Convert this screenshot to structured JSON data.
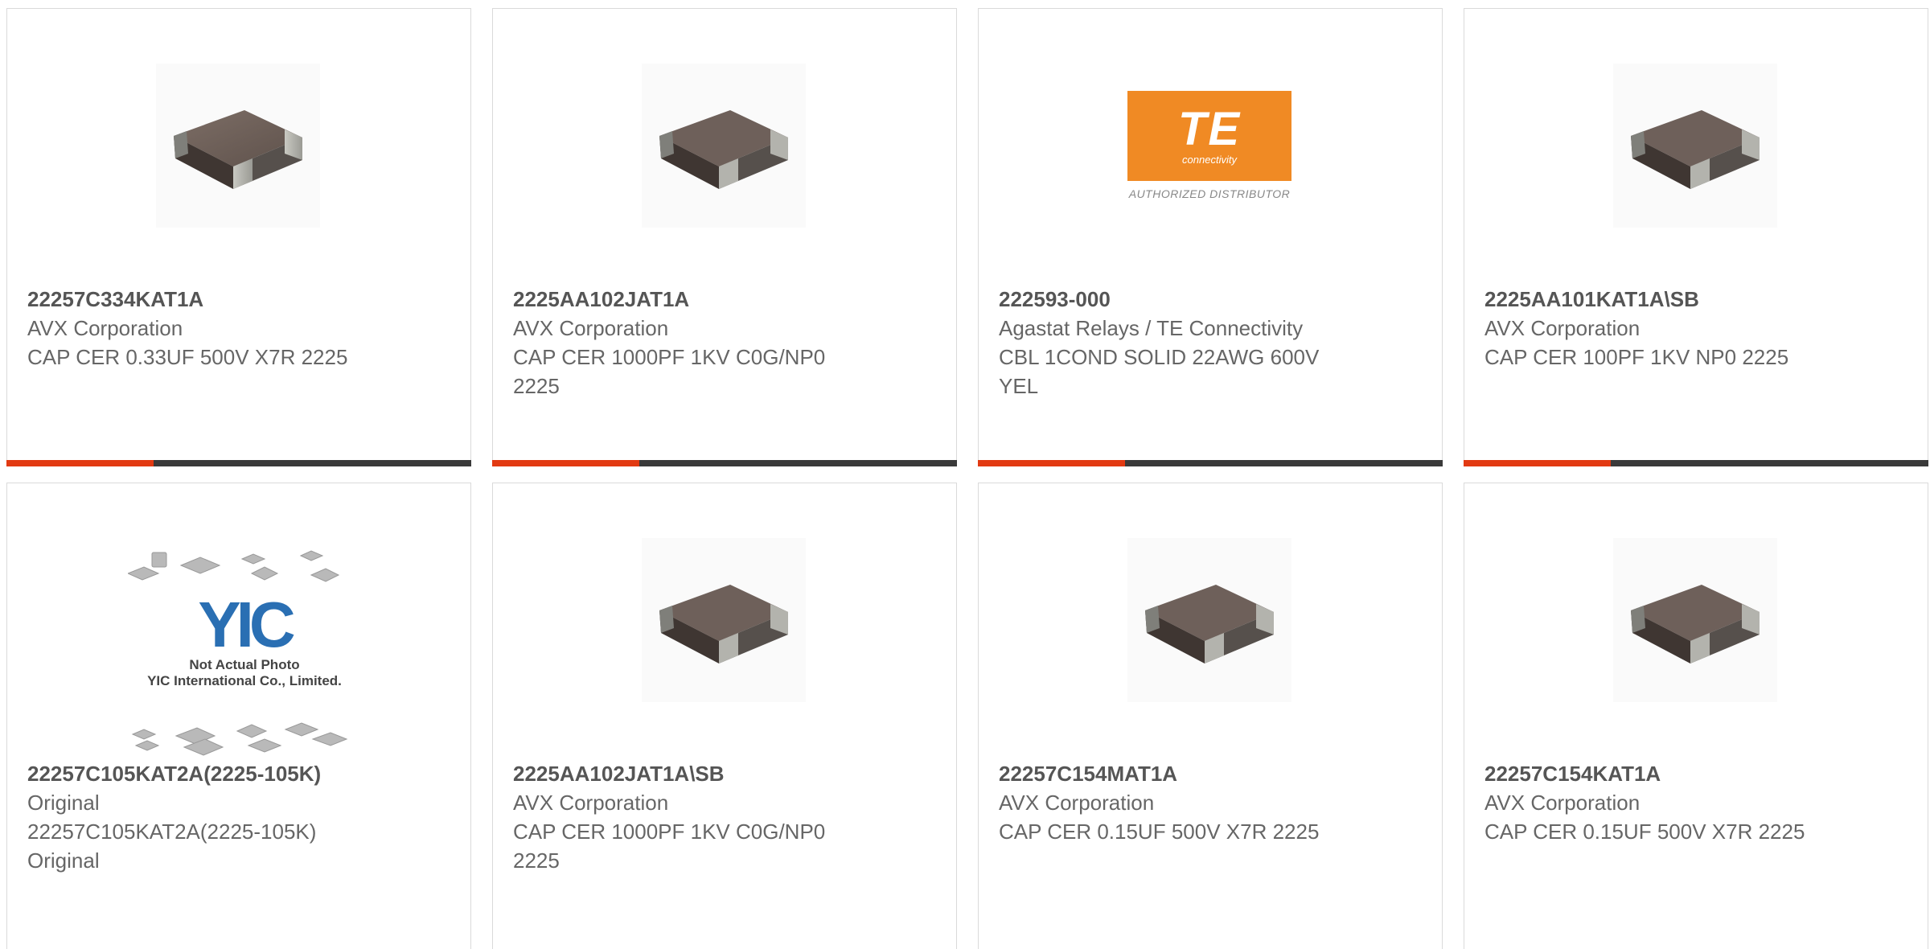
{
  "products": [
    {
      "part_number": "22257C334KAT1A",
      "manufacturer": "AVX Corporation",
      "description": "CAP CER 0.33UF 500V X7R 2225",
      "image": "ceramic-capacitor-image"
    },
    {
      "part_number": "2225AA102JAT1A",
      "manufacturer": "AVX Corporation",
      "description": "CAP CER 1000PF 1KV C0G/NP0 2225",
      "image": "ceramic-capacitor-image"
    },
    {
      "part_number": "222593-000",
      "manufacturer": "Agastat Relays / TE Connectivity",
      "description": "CBL 1COND SOLID 22AWG 600V YEL",
      "image": "te-connectivity-logo"
    },
    {
      "part_number": "2225AA101KAT1A\\SB",
      "manufacturer": "AVX Corporation",
      "description": "CAP CER 100PF 1KV NP0 2225",
      "image": "ceramic-capacitor-image"
    },
    {
      "part_number": "22257C105KAT2A(2225-105K)",
      "manufacturer": "Original",
      "description": "22257C105KAT2A(2225-105K) Original",
      "image": "not-actual-photo-placeholder"
    },
    {
      "part_number": "2225AA102JAT1A\\SB",
      "manufacturer": "AVX Corporation",
      "description": "CAP CER 1000PF 1KV C0G/NP0 2225",
      "image": "ceramic-capacitor-image"
    },
    {
      "part_number": "22257C154MAT1A",
      "manufacturer": "AVX Corporation",
      "description": "CAP CER 0.15UF 500V X7R 2225",
      "image": "ceramic-capacitor-image"
    },
    {
      "part_number": "22257C154KAT1A",
      "manufacturer": "AVX Corporation",
      "description": "CAP CER 0.15UF 500V X7R 2225",
      "image": "ceramic-capacitor-image"
    }
  ],
  "te_logo": {
    "main": "TE",
    "sub": "connectivity",
    "tagline": "AUTHORIZED DISTRIBUTOR"
  },
  "yic_placeholder": {
    "logo": "YIC",
    "line1": "Not Actual Photo",
    "line2": "YIC International Co., Limited."
  },
  "colors": {
    "accent": "#e23a12",
    "bar": "#3a3a3a",
    "te_orange": "#f08a24",
    "yic_blue": "#2a6fb3"
  }
}
